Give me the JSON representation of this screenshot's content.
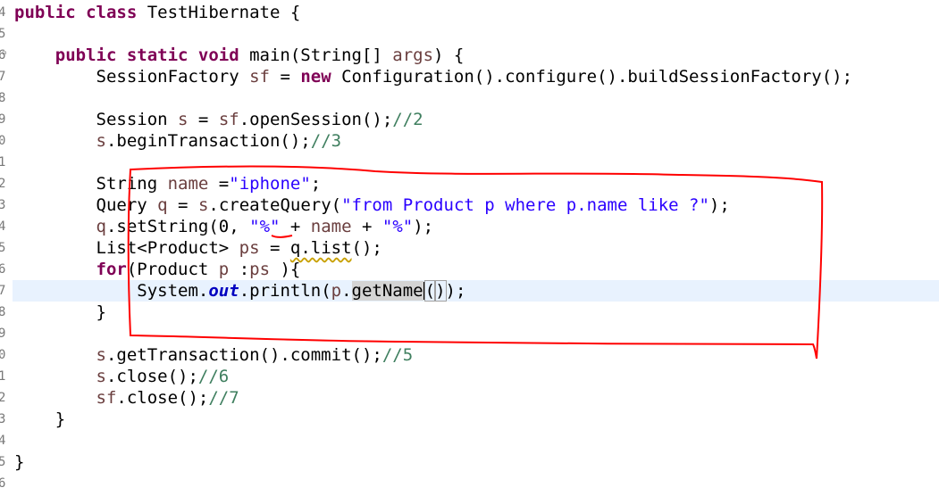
{
  "editor": {
    "line_numbers": [
      "4",
      "5",
      "6",
      "7",
      "8",
      "9",
      "0",
      "1",
      "2",
      "3",
      "4",
      "5",
      "6",
      "7",
      "8",
      "9",
      "0",
      "1",
      "2",
      "3",
      "4",
      "5",
      "6"
    ],
    "lines": [
      {
        "indent": "",
        "tokens": [
          {
            "t": "public class",
            "c": "kw"
          },
          {
            "t": " TestHibernate {"
          }
        ]
      },
      {
        "indent": "",
        "tokens": []
      },
      {
        "indent": "    ",
        "tokens": [
          {
            "t": "public static void",
            "c": "kw"
          },
          {
            "t": " main(String[] "
          },
          {
            "t": "args",
            "c": "var"
          },
          {
            "t": ") {"
          }
        ]
      },
      {
        "indent": "        ",
        "tokens": [
          {
            "t": "SessionFactory "
          },
          {
            "t": "sf",
            "c": "var"
          },
          {
            "t": " = "
          },
          {
            "t": "new",
            "c": "kw"
          },
          {
            "t": " Configuration().configure().buildSessionFactory();"
          }
        ]
      },
      {
        "indent": "",
        "tokens": []
      },
      {
        "indent": "        ",
        "tokens": [
          {
            "t": "Session "
          },
          {
            "t": "s",
            "c": "var"
          },
          {
            "t": " = "
          },
          {
            "t": "sf",
            "c": "var"
          },
          {
            "t": ".openSession();"
          },
          {
            "t": "//2",
            "c": "cm"
          }
        ]
      },
      {
        "indent": "        ",
        "tokens": [
          {
            "t": "s",
            "c": "var"
          },
          {
            "t": ".beginTransaction();"
          },
          {
            "t": "//3",
            "c": "cm"
          }
        ]
      },
      {
        "indent": "",
        "tokens": []
      },
      {
        "indent": "        ",
        "tokens": [
          {
            "t": "String "
          },
          {
            "t": "name",
            "c": "var"
          },
          {
            "t": " ="
          },
          {
            "t": "\"iphone\"",
            "c": "str"
          },
          {
            "t": ";"
          }
        ]
      },
      {
        "indent": "        ",
        "tokens": [
          {
            "t": "Query "
          },
          {
            "t": "q",
            "c": "var"
          },
          {
            "t": " = "
          },
          {
            "t": "s",
            "c": "var"
          },
          {
            "t": ".createQuery("
          },
          {
            "t": "\"from Product p where p.name like ?\"",
            "c": "str"
          },
          {
            "t": ");"
          }
        ]
      },
      {
        "indent": "        ",
        "tokens": [
          {
            "t": "q",
            "c": "var"
          },
          {
            "t": ".setString(0, "
          },
          {
            "t": "\"%\"",
            "c": "str"
          },
          {
            "t": " + "
          },
          {
            "t": "name",
            "c": "var"
          },
          {
            "t": " + "
          },
          {
            "t": "\"%\"",
            "c": "str"
          },
          {
            "t": ");"
          }
        ]
      },
      {
        "indent": "        ",
        "tokens": [
          {
            "t": "List<Product> "
          },
          {
            "t": "ps",
            "c": "var"
          },
          {
            "t": " = "
          },
          {
            "t": "q.list",
            "c": "warn"
          },
          {
            "t": "();"
          }
        ]
      },
      {
        "indent": "        ",
        "tokens": [
          {
            "t": "for",
            "c": "kw"
          },
          {
            "t": "(Product "
          },
          {
            "t": "p",
            "c": "var"
          },
          {
            "t": " :"
          },
          {
            "t": "ps",
            "c": "var"
          },
          {
            "t": " ){"
          }
        ]
      },
      {
        "indent": "            ",
        "tokens": [
          {
            "t": "System."
          },
          {
            "t": "out",
            "c": "fld"
          },
          {
            "t": ".println("
          },
          {
            "t": "p",
            "c": "var"
          },
          {
            "t": "."
          },
          {
            "t": "getName",
            "c": "hl"
          },
          {
            "t": "",
            "c": "caret"
          },
          {
            "t": "(",
            "c": "bracket"
          },
          {
            "t": ")",
            "c": "bracket"
          },
          {
            "t": ");"
          }
        ]
      },
      {
        "indent": "        ",
        "tokens": [
          {
            "t": "}"
          }
        ]
      },
      {
        "indent": "",
        "tokens": []
      },
      {
        "indent": "        ",
        "tokens": [
          {
            "t": "s",
            "c": "var"
          },
          {
            "t": ".getTransaction().commit();"
          },
          {
            "t": "//5",
            "c": "cm"
          }
        ]
      },
      {
        "indent": "        ",
        "tokens": [
          {
            "t": "s",
            "c": "var"
          },
          {
            "t": ".close();"
          },
          {
            "t": "//6",
            "c": "cm"
          }
        ]
      },
      {
        "indent": "        ",
        "tokens": [
          {
            "t": "sf",
            "c": "var"
          },
          {
            "t": ".close();"
          },
          {
            "t": "//7",
            "c": "cm"
          }
        ]
      },
      {
        "indent": "    ",
        "tokens": [
          {
            "t": "}"
          }
        ]
      },
      {
        "indent": "",
        "tokens": []
      },
      {
        "indent": "",
        "tokens": [
          {
            "t": "}"
          }
        ]
      },
      {
        "indent": "",
        "tokens": []
      }
    ],
    "fold_marker": "⊖",
    "colors": {
      "keyword": "#7f0055",
      "string": "#2a00ff",
      "comment": "#3f7f5f",
      "field": "#0000c0",
      "variable": "#6a3e3e",
      "current_line": "#e8f2fe",
      "annotation": "#ff0000"
    }
  }
}
